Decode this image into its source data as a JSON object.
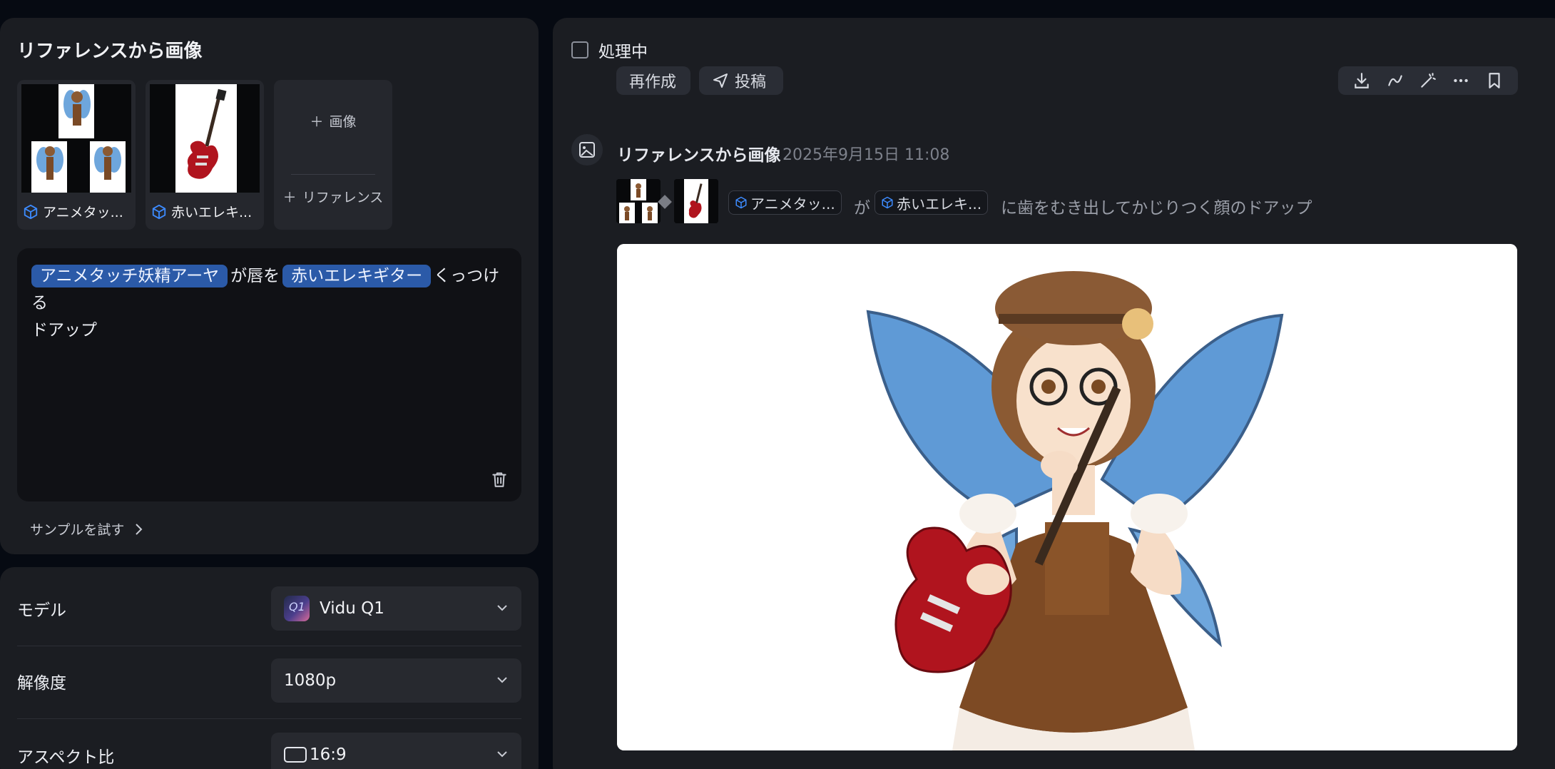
{
  "reference_panel": {
    "title": "リファレンスから画像",
    "references": [
      {
        "label": "アニメタッ..."
      },
      {
        "label": "赤いエレキ..."
      }
    ],
    "add_image_label": "画像",
    "add_reference_label": "リファレンス",
    "prompt": {
      "chip1": "アニメタッチ妖精アーヤ",
      "text1": "が唇を",
      "chip2": "赤いエレキギター",
      "text2": "くっつける",
      "text3": "ドアップ"
    },
    "sample_link": "サンプルを試す"
  },
  "settings": {
    "model": {
      "label": "モデル",
      "value": "Vidu Q1",
      "logo_text": "Q1"
    },
    "resolution": {
      "label": "解像度",
      "value": "1080p"
    },
    "aspect": {
      "label": "アスペクト比",
      "value": "16:9"
    }
  },
  "result": {
    "processing_label": "処理中",
    "actions": {
      "regenerate": "再作成",
      "post": "投稿"
    },
    "entry": {
      "title": "リファレンスから画像",
      "timestamp": "2025年9月15日 11:08",
      "tag1": "アニメタッ...",
      "connector": "が",
      "tag2": "赤いエレキ...",
      "prompt_rest": "に歯をむき出してかじりつく顔のドアップ"
    }
  },
  "colors": {
    "background": "#060a12",
    "panel": "#1b1d22",
    "chip": "#2b5aa8",
    "accent_icon": "#3d8bff"
  }
}
